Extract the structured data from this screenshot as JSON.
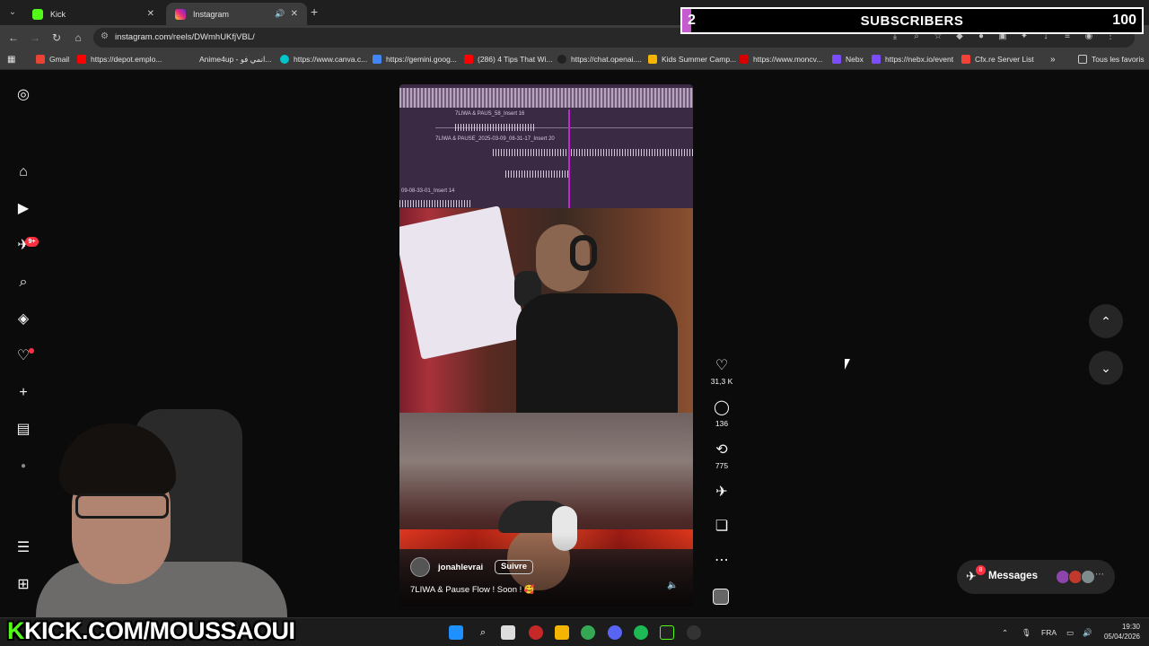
{
  "browser": {
    "tabs": [
      {
        "label": "Kick",
        "favicon": "kick-icon"
      },
      {
        "label": "Instagram",
        "favicon": "instagram-icon"
      }
    ],
    "url": "instagram.com/reels/DWmhUKfjVBL/",
    "bookmarks": [
      {
        "label": "Gmail",
        "color": "#ea4335"
      },
      {
        "label": "https://depot.emplo...",
        "color": "#ff0000"
      },
      {
        "label": "Anime4up - انمي فو...",
        "color": "#3c3c3c"
      },
      {
        "label": "https://www.canva.c...",
        "color": "#00c4cc"
      },
      {
        "label": "https://gemini.goog...",
        "color": "#4285f4"
      },
      {
        "label": "(286) 4 Tips That Wi...",
        "color": "#ff0000"
      },
      {
        "label": "https://chat.openai....",
        "color": "#202123"
      },
      {
        "label": "Kids Summer Camp...",
        "color": "#f4b400"
      },
      {
        "label": "https://www.moncv...",
        "color": "#d50000"
      },
      {
        "label": "Nebx",
        "color": "#7c4dff"
      },
      {
        "label": "https://nebx.io/event",
        "color": "#7c4dff"
      },
      {
        "label": "Cfx.re Server List",
        "color": "#f44336"
      }
    ],
    "all_bookmarks": "Tous les favoris"
  },
  "overlay": {
    "current": "2",
    "title": "SUBSCRIBERS",
    "goal": "100",
    "progress": 0.02,
    "fill_color": "#c45ccf"
  },
  "reel": {
    "daw_clips": [
      "7LIWA & PAUS_58_Insert 16",
      "7LIWA & PAUSE_2025-03-09_08-31-17_Insert 20",
      "09-08-33-01_Insert 14"
    ],
    "username": "jonahlevrai",
    "follow_label": "Suivre",
    "caption": "7LIWA & Pause Flow ! Soon ! 🥰"
  },
  "actions": {
    "likes": "31,3 K",
    "comments": "136",
    "reposts": "775"
  },
  "messages": {
    "label": "Messages",
    "badge": "8"
  },
  "sidebar": {
    "notifications_badge": "9+"
  },
  "stream": {
    "brand_k": "K",
    "brand_rest": "KICK.COM/MOUSSAOUI"
  },
  "taskbar": {
    "language": "FRA",
    "time": "19:30",
    "date": "05/04/2026"
  }
}
